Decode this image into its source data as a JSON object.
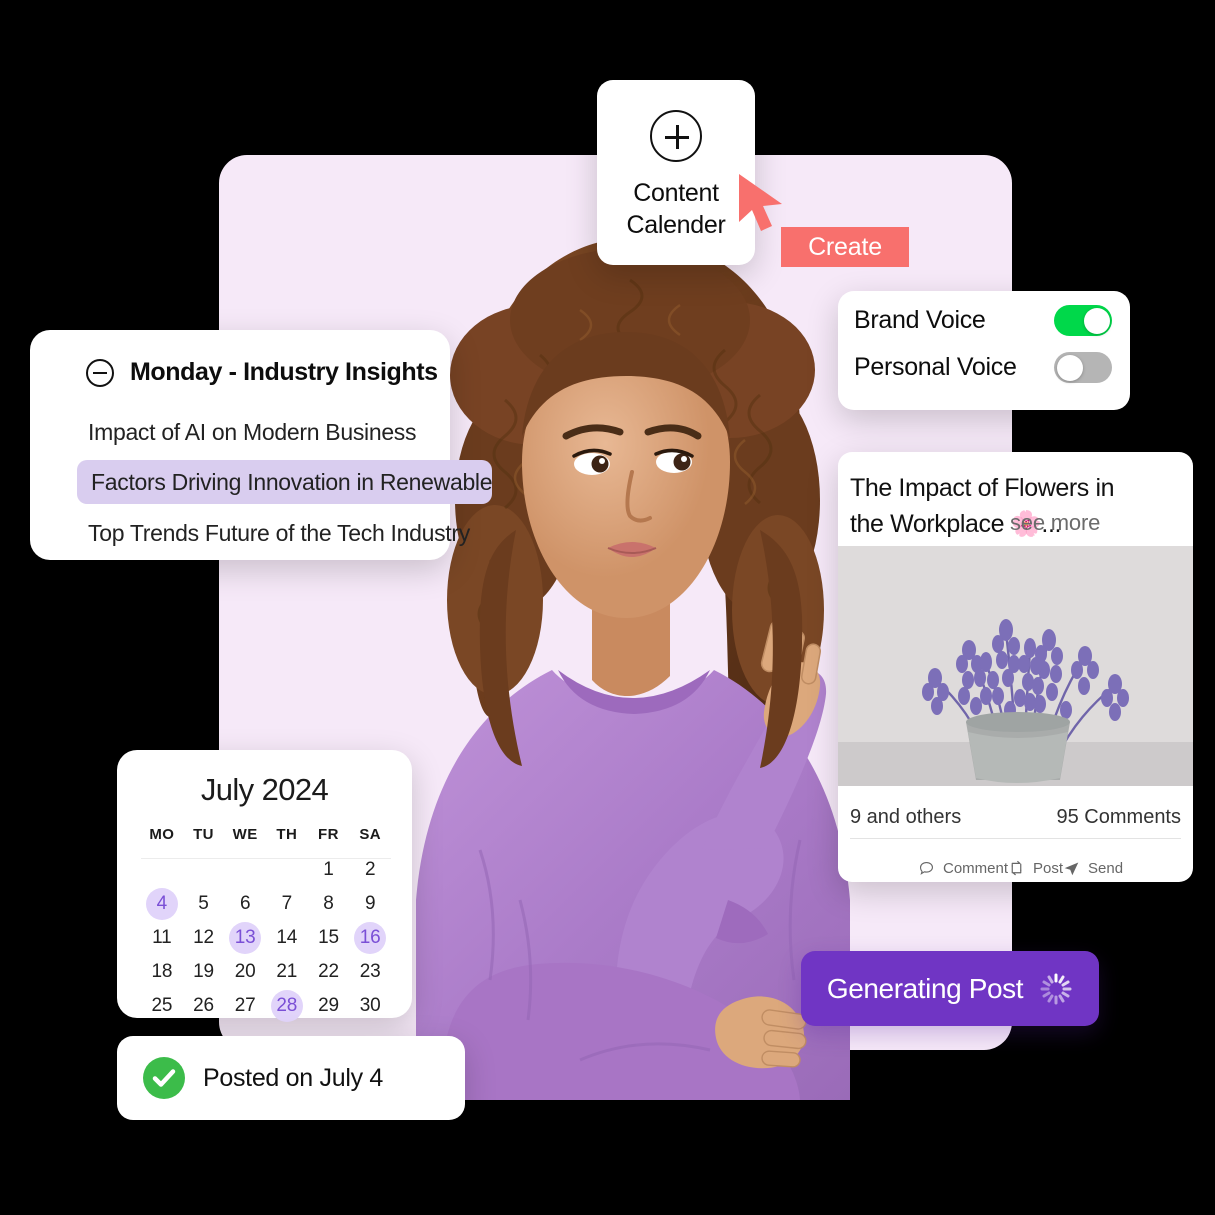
{
  "theme": {
    "panel_bg": "#f6e9f8",
    "accent_coral": "#f8706d",
    "accent_purple": "#7035c4",
    "highlight_lavender": "#e1d4fa",
    "toggle_on_green": "#00d84a",
    "toggle_off_gray": "#b5b5b5",
    "success_green": "#3cbc4a"
  },
  "content_calendar": {
    "icon": "plus-circle-icon",
    "label_line1": "Content",
    "label_line2": "Calender"
  },
  "create_button": {
    "label": "Create"
  },
  "cursor": {
    "icon": "mouse-pointer-icon"
  },
  "voice_settings": {
    "rows": [
      {
        "label": "Brand Voice",
        "state": "on"
      },
      {
        "label": "Personal Voice",
        "state": "off"
      }
    ]
  },
  "insights": {
    "collapse_icon": "minus-circle-icon",
    "title": "Monday - Industry Insights",
    "items": [
      {
        "text": "Impact of AI on Modern Business",
        "selected": false
      },
      {
        "text": "Factors Driving Innovation in Renewable",
        "selected": true
      },
      {
        "text": "Top Trends Future of the Tech Industry",
        "selected": false
      }
    ]
  },
  "post_preview": {
    "title": "The Impact of Flowers in the Workplace",
    "title_emoji": "🌸",
    "title_ellipsis": "...",
    "see_more": "see more",
    "image_alt": "lavender-plant-in-gray-pot",
    "reactions": "9 and others",
    "comments": "95 Comments",
    "actions": [
      {
        "label": "Comment",
        "icon": "comment-icon"
      },
      {
        "label": "Post",
        "icon": "repost-icon"
      },
      {
        "label": "Send",
        "icon": "send-icon"
      }
    ]
  },
  "calendar": {
    "title": "July 2024",
    "weekdays": [
      "MO",
      "TU",
      "WE",
      "TH",
      "FR",
      "SA"
    ],
    "weeks": [
      [
        "",
        "",
        "",
        "",
        "1",
        "2"
      ],
      [
        "4",
        "5",
        "6",
        "7",
        "8",
        "9"
      ],
      [
        "11",
        "12",
        "13",
        "14",
        "15",
        "16"
      ],
      [
        "18",
        "19",
        "20",
        "21",
        "22",
        "23"
      ],
      [
        "25",
        "26",
        "27",
        "28",
        "29",
        "30"
      ]
    ],
    "highlighted_days": [
      "4",
      "13",
      "16",
      "28"
    ]
  },
  "toast": {
    "icon": "check-circle-icon",
    "label": "Posted on July 4"
  },
  "generating_button": {
    "label": "Generating Post",
    "icon": "loading-spinner-icon"
  }
}
